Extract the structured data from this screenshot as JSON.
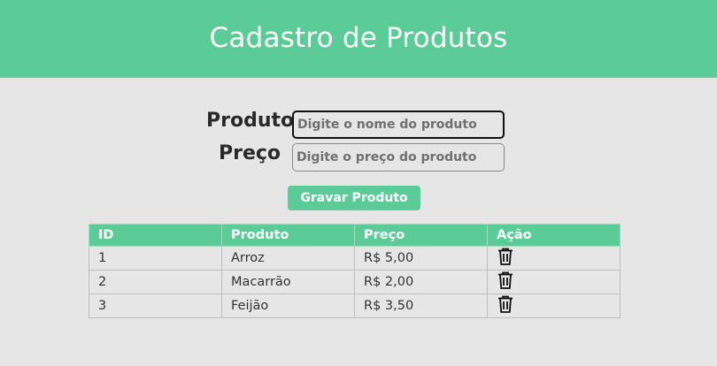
{
  "header": {
    "title": "Cadastro de Produtos"
  },
  "form": {
    "product_label": "Produto",
    "product_placeholder": "Digite o nome do produto",
    "price_label": "Preço",
    "price_placeholder": "Digite o preço do produto",
    "save_label": "Gravar Produto"
  },
  "table": {
    "headers": {
      "id": "ID",
      "product": "Produto",
      "price": "Preço",
      "action": "Ação"
    },
    "rows": [
      {
        "id": "1",
        "product": "Arroz",
        "price": "R$ 5,00",
        "action_icon": "trash-icon"
      },
      {
        "id": "2",
        "product": "Macarrão",
        "price": "R$ 2,00",
        "action_icon": "trash-icon"
      },
      {
        "id": "3",
        "product": "Feijão",
        "price": "R$ 3,50",
        "action_icon": "trash-icon"
      }
    ]
  },
  "colors": {
    "accent": "#5bcb97",
    "background": "#e6e6e6",
    "header_text": "#ffffff"
  }
}
